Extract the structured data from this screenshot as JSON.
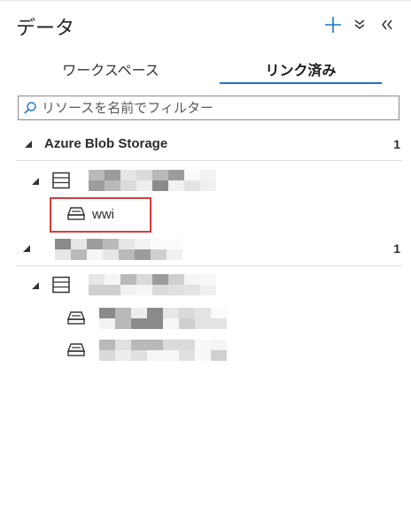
{
  "header": {
    "title": "データ",
    "add_icon": "plus-icon",
    "expand_icon": "chevron-double-down-icon",
    "collapse_icon": "chevron-double-left-icon",
    "accent_color": "#1b74c8"
  },
  "tabs": [
    {
      "label": "ワークスペース",
      "selected": false
    },
    {
      "label": "リンク済み",
      "selected": true
    }
  ],
  "filter": {
    "placeholder": "リソースを名前でフィルター",
    "value": ""
  },
  "tree": {
    "group1": {
      "label": "Azure Blob Storage",
      "count": "1",
      "account": {
        "label": "",
        "container": {
          "label": "wwi",
          "highlighted": true
        }
      }
    },
    "group2": {
      "label": "",
      "count": "1",
      "account": {
        "label": "",
        "containers": [
          {
            "label": ""
          },
          {
            "label": ""
          }
        ]
      }
    }
  },
  "highlight_color": "#d83b3b"
}
